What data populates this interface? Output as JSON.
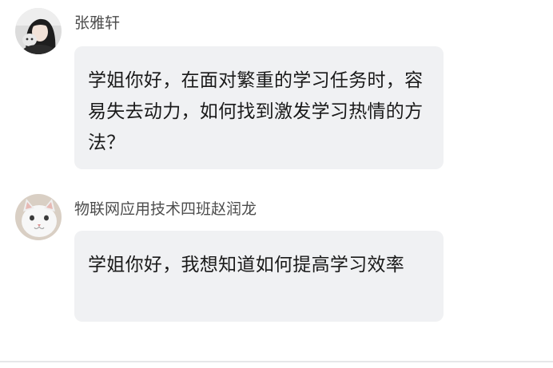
{
  "messages": [
    {
      "sender": "张雅轩",
      "avatar": "avatar-photo-girl",
      "text": "学姐你好，在面对繁重的学习任务时，容易失去动力，如何找到激发学习热情的方法？"
    },
    {
      "sender": "物联网应用技术四班赵润龙",
      "avatar": "avatar-photo-cat",
      "text": "学姐你好，我想知道如何提高学习效率"
    }
  ],
  "colors": {
    "bubble_background": "#f0f1f3",
    "sender_name": "#4d4d4d",
    "message_text": "#1a1a1a"
  }
}
